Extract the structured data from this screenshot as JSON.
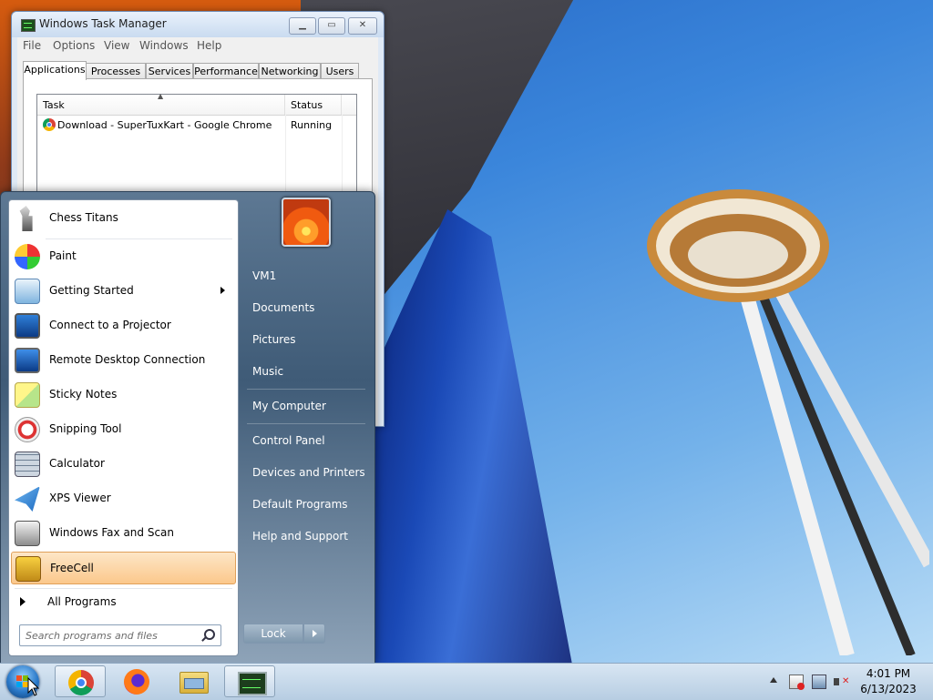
{
  "task_manager": {
    "title": "Windows Task Manager",
    "menu": [
      "File",
      "Options",
      "View",
      "Windows",
      "Help"
    ],
    "tabs": [
      "Applications",
      "Processes",
      "Services",
      "Performance",
      "Networking",
      "Users"
    ],
    "active_tab": "Applications",
    "columns": [
      "Task",
      "Status"
    ],
    "rows": [
      {
        "task": "Download - SuperTuxKart - Google Chrome",
        "status": "Running"
      }
    ]
  },
  "start_menu": {
    "programs": [
      {
        "label": "Chess Titans",
        "icon": "chess-icon"
      },
      {
        "label": "Paint",
        "icon": "paint-icon"
      },
      {
        "label": "Getting Started",
        "icon": "getting-started-icon",
        "has_submenu": true
      },
      {
        "label": "Connect to a Projector",
        "icon": "projector-icon"
      },
      {
        "label": "Remote Desktop Connection",
        "icon": "remote-desktop-icon"
      },
      {
        "label": "Sticky Notes",
        "icon": "sticky-notes-icon"
      },
      {
        "label": "Snipping Tool",
        "icon": "snipping-tool-icon"
      },
      {
        "label": "Calculator",
        "icon": "calculator-icon"
      },
      {
        "label": "XPS Viewer",
        "icon": "xps-viewer-icon"
      },
      {
        "label": "Windows Fax and Scan",
        "icon": "fax-scan-icon"
      },
      {
        "label": "FreeCell",
        "icon": "freecell-icon",
        "highlighted": true
      }
    ],
    "all_programs": "All Programs",
    "search_placeholder": "Search programs and files",
    "right_links": [
      "VM1",
      "Documents",
      "Pictures",
      "Music",
      "My Computer",
      "Control Panel",
      "Devices and Printers",
      "Default Programs",
      "Help and Support"
    ],
    "lock_label": "Lock"
  },
  "taskbar": {
    "pinned": [
      "start-orb",
      "chrome-icon",
      "firefox-icon",
      "explorer-icon",
      "task-manager-icon"
    ],
    "tray_icons": [
      "show-hidden-icon",
      "action-center-icon",
      "network-icon",
      "volume-muted-icon"
    ],
    "time": "4:01 PM",
    "date": "6/13/2023"
  }
}
